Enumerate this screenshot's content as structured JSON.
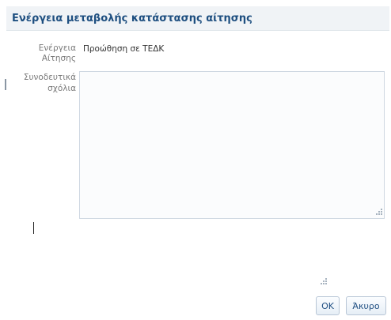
{
  "dialog": {
    "title": "Ενέργεια μεταβολής κατάστασης αίτησης"
  },
  "form": {
    "action_label_line1": "Ενέργεια",
    "action_label_line2": "Αίτησης",
    "action_value": "Προώθηση σε ΤΕΔΚ",
    "comments_label_line1": "Συνοδευτικά",
    "comments_label_line2": "σχόλια",
    "comments_value": ""
  },
  "buttons": {
    "ok_label": "OK",
    "cancel_label": "Άκυρο"
  },
  "colors": {
    "title": "#1e4f80",
    "button_text": "#1f4e82",
    "label_text": "#7a7a7a"
  }
}
